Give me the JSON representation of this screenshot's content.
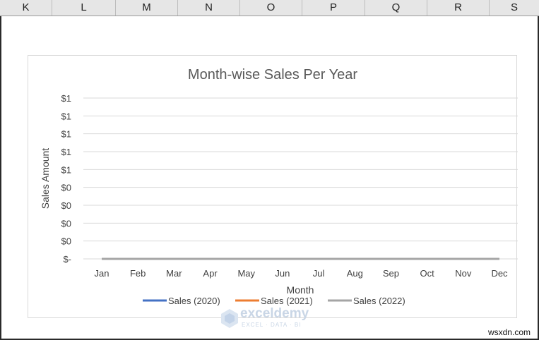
{
  "column_headers": [
    "K",
    "L",
    "M",
    "N",
    "O",
    "P",
    "Q",
    "R",
    "S"
  ],
  "chart_data": {
    "type": "line",
    "title": "Month-wise Sales Per Year",
    "xlabel": "Month",
    "ylabel": "Sales Amount",
    "categories": [
      "Jan",
      "Feb",
      "Mar",
      "Apr",
      "May",
      "Jun",
      "Jul",
      "Aug",
      "Sep",
      "Oct",
      "Nov",
      "Dec"
    ],
    "y_tick_labels": [
      "$1",
      "$1",
      "$1",
      "$1",
      "$1",
      "$0",
      "$0",
      "$0",
      "$0",
      "$-"
    ],
    "ylim": [
      0,
      1
    ],
    "grid": true,
    "legend_position": "bottom",
    "series": [
      {
        "name": "Sales (2020)",
        "color": "#4472c4",
        "values": [
          0,
          0,
          0,
          0,
          0,
          0,
          0,
          0,
          0,
          0,
          0,
          0
        ]
      },
      {
        "name": "Sales (2021)",
        "color": "#ed7d31",
        "values": [
          0,
          0,
          0,
          0,
          0,
          0,
          0,
          0,
          0,
          0,
          0,
          0
        ]
      },
      {
        "name": "Sales (2022)",
        "color": "#a5a5a5",
        "values": [
          0,
          0,
          0,
          0,
          0,
          0,
          0,
          0,
          0,
          0,
          0,
          0
        ]
      }
    ]
  },
  "watermark": {
    "name": "exceldemy",
    "tagline": "EXCEL · DATA · BI"
  },
  "site_mark": "wsxdn.com"
}
